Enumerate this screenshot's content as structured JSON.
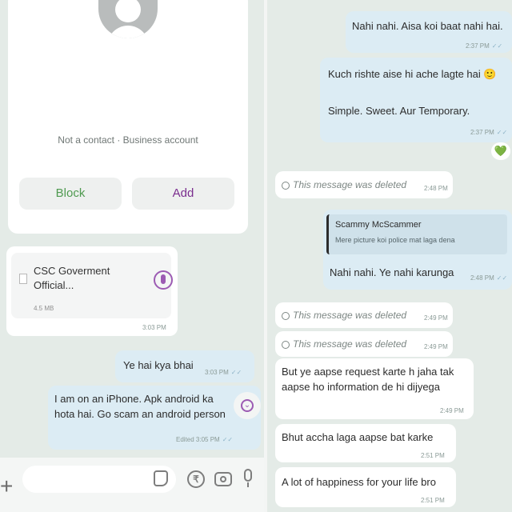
{
  "left": {
    "contact_card": {
      "status": "Not a contact · Business account",
      "block_label": "Block",
      "add_label": "Add"
    },
    "document": {
      "title": "CSC Goverment Official...",
      "size": "4.5 MB",
      "time": "3:03 PM"
    },
    "messages": [
      {
        "text": "Ye hai kya bhai",
        "time": "3:03 PM"
      },
      {
        "text": "I am on an iPhone. Apk android ka hota hai. Go scam an android person",
        "time": "Edited 3:05 PM"
      }
    ],
    "input": {
      "placeholder": ""
    }
  },
  "right": {
    "messages": [
      {
        "text": "Nahi nahi. Aisa koi baat nahi hai.",
        "time": "2:37 PM"
      },
      {
        "text": "Kuch rishte aise hi ache lagte hai 🙂",
        "text2": "Simple. Sweet. Aur Temporary.",
        "time": "2:37 PM"
      },
      {
        "reaction": "💚"
      },
      {
        "deleted": "This message was deleted",
        "time": "2:48 PM"
      },
      {
        "quote_name": "Scammy McScammer",
        "quote_text": "Mere picture koi police mat laga dena",
        "text": "Nahi nahi. Ye nahi karunga",
        "time": "2:48 PM"
      },
      {
        "deleted": "This message was deleted",
        "time": "2:49 PM"
      },
      {
        "deleted": "This message was deleted",
        "time": "2:49 PM"
      },
      {
        "text": "But ye aapse request karte h jaha tak aapse ho information de hi dijyega",
        "time": "2:49 PM"
      },
      {
        "text": "Bhut accha laga aapse bat karke",
        "time": "2:51 PM"
      },
      {
        "text": "A lot of happiness for your life bro",
        "time": "2:51 PM"
      }
    ]
  },
  "ticks": "✓✓",
  "colors": {
    "incoming": "#ffffff",
    "outgoing": "#dcecf4",
    "accent_purple": "#7a2d8e",
    "block_green": "#4f9a50",
    "background": "#e4ebe7"
  },
  "icons": [
    "plus-icon",
    "sticker-icon",
    "rupee-icon",
    "camera-icon",
    "mic-icon",
    "download-icon",
    "scroll-down-icon",
    "ban-icon"
  ]
}
